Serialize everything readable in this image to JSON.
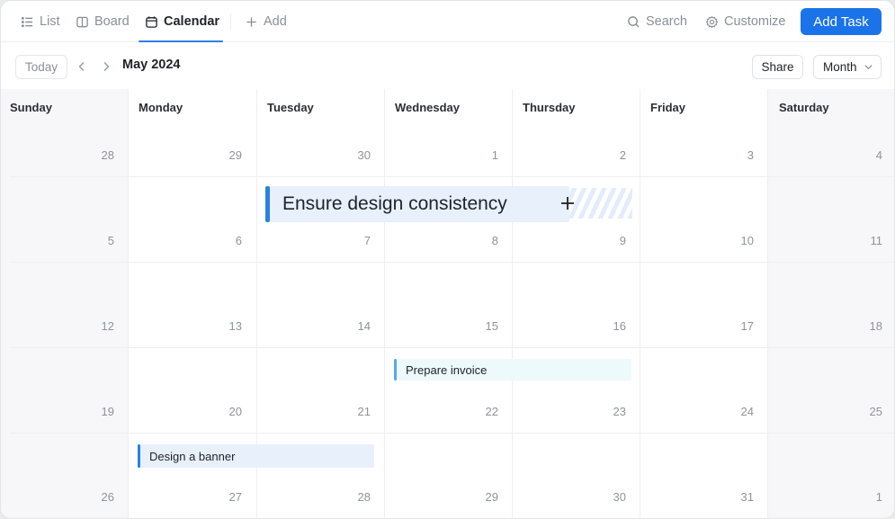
{
  "tabs": [
    {
      "label": "List",
      "icon": "list-icon",
      "active": false
    },
    {
      "label": "Board",
      "icon": "board-icon",
      "active": false
    },
    {
      "label": "Calendar",
      "icon": "calendar-icon",
      "active": true
    },
    {
      "label": "Add",
      "icon": "plus-icon",
      "active": false
    }
  ],
  "tools": {
    "search_label": "Search",
    "customize_label": "Customize",
    "add_task_label": "Add Task"
  },
  "colors": {
    "accent": "#1a73e8",
    "event_blue_bg": "#e8f0fc",
    "event_teal_bg": "#edf9fb",
    "weekend_bg": "#f7f7fa"
  },
  "toolbar": {
    "today_label": "Today",
    "prev_icon": "chevron-left-icon",
    "next_icon": "chevron-right-icon",
    "month_title": "May 2024",
    "share_label": "Share",
    "view_select": "Month"
  },
  "calendar": {
    "day_names": [
      "Sunday",
      "Monday",
      "Tuesday",
      "Wednesday",
      "Thursday",
      "Friday",
      "Saturday"
    ],
    "weeks": [
      [
        "28",
        "29",
        "30",
        "1",
        "2",
        "3",
        "4"
      ],
      [
        "5",
        "6",
        "7",
        "8",
        "9",
        "10",
        "11"
      ],
      [
        "12",
        "13",
        "14",
        "15",
        "16",
        "17",
        "18"
      ],
      [
        "19",
        "20",
        "21",
        "22",
        "23",
        "24",
        "25"
      ],
      [
        "26",
        "27",
        "28",
        "29",
        "30",
        "31",
        "1"
      ]
    ],
    "events": [
      {
        "title": "Ensure design consistency",
        "start": "May 7",
        "end": "May 9",
        "state": "dragging"
      },
      {
        "title": "Prepare invoice",
        "start": "May 22",
        "end": "May 23"
      },
      {
        "title": "Design a banner",
        "start": "May 27",
        "end": "May 28"
      }
    ]
  }
}
